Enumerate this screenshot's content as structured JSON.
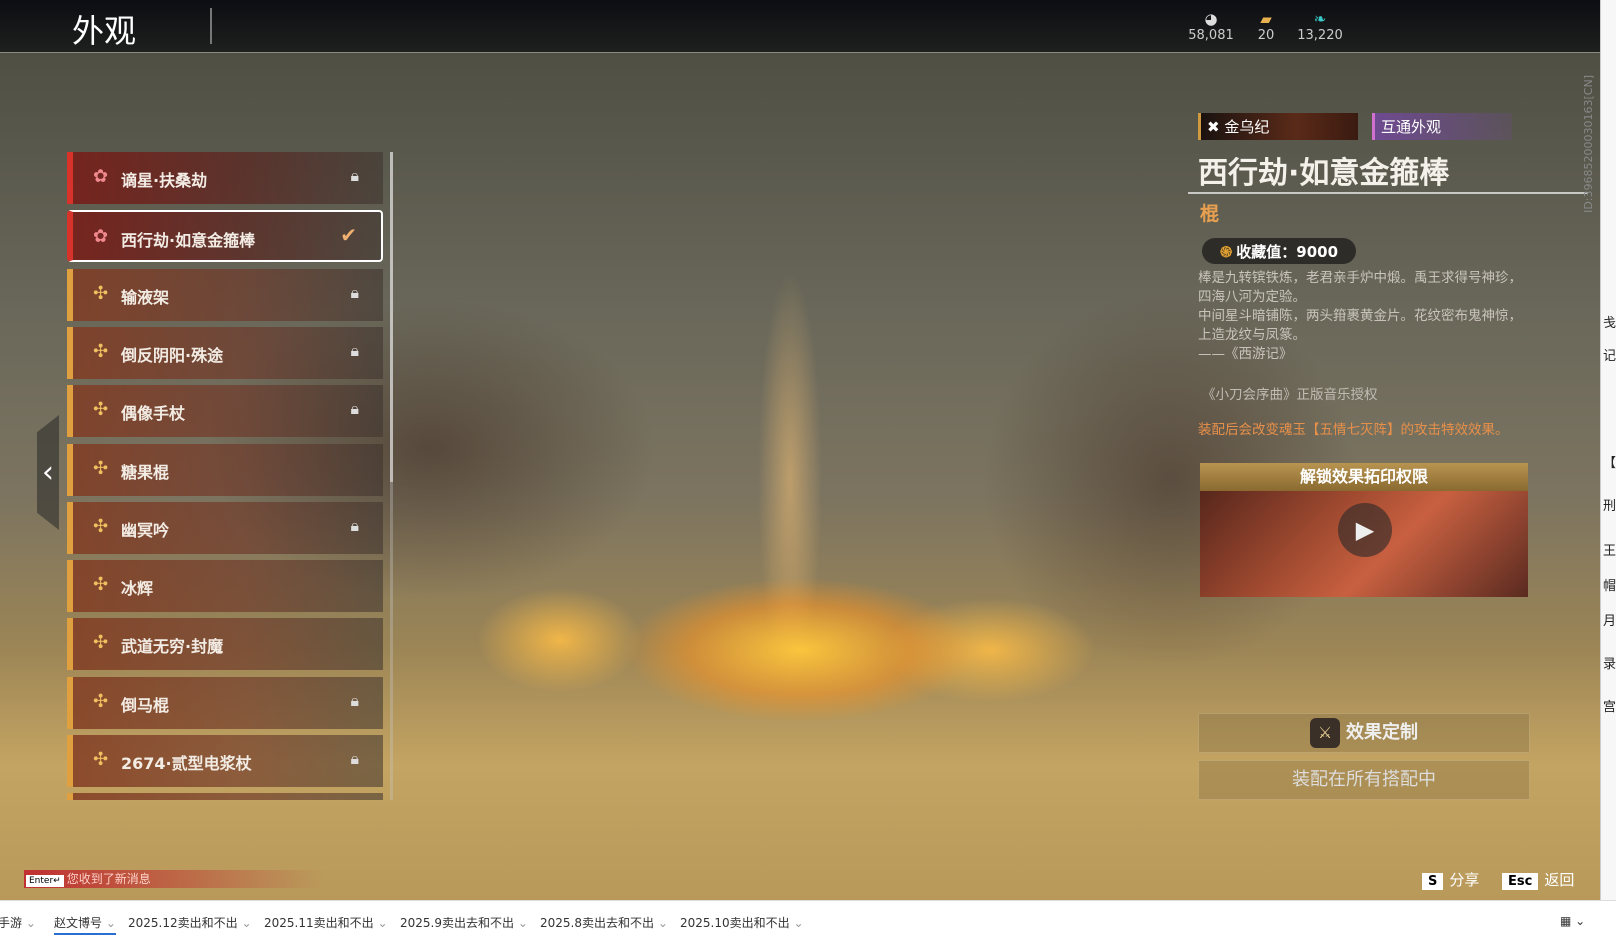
{
  "header": {
    "title": "外观",
    "currencies": [
      {
        "icon": "coin-icon",
        "value": "58,081"
      },
      {
        "icon": "ticket-icon",
        "value": "20"
      },
      {
        "icon": "feather-icon",
        "value": "13,220"
      }
    ]
  },
  "list": [
    {
      "name": "谪星·扶桑劫",
      "rarity": "red",
      "locked": true,
      "selected": false
    },
    {
      "name": "西行劫·如意金箍棒",
      "rarity": "red",
      "locked": false,
      "selected": true
    },
    {
      "name": "输液架",
      "rarity": "gold",
      "locked": true
    },
    {
      "name": "倒反阴阳·殊途",
      "rarity": "gold",
      "locked": true
    },
    {
      "name": "偶像手杖",
      "rarity": "gold",
      "locked": true
    },
    {
      "name": "糖果棍",
      "rarity": "gold",
      "locked": false
    },
    {
      "name": "幽冥吟",
      "rarity": "gold",
      "locked": true
    },
    {
      "name": "冰辉",
      "rarity": "gold",
      "locked": false
    },
    {
      "name": "武道无穷·封魔",
      "rarity": "gold",
      "locked": false
    },
    {
      "name": "倒马棍",
      "rarity": "gold",
      "locked": true
    },
    {
      "name": "2674·贰型电浆杖",
      "rarity": "gold",
      "locked": true
    }
  ],
  "detail": {
    "tag_series": "金乌纪",
    "tag_shared": "互通外观",
    "name": "西行劫·如意金箍棒",
    "type": "棍",
    "collect_label": "收藏值：9000",
    "desc": [
      "棒是九转镔铁炼，老君亲手炉中煅。禹王求得号神珍，四海八河为定验。",
      "中间星斗暗铺陈，两头箝裹黄金片。花纹密布鬼神惊，上造龙纹与凤篆。",
      "——《西游记》"
    ],
    "music": "《小刀会序曲》正版音乐授权",
    "effect": "装配后会改变魂玉【五情七灭阵】的攻击特效效果。",
    "video_title": "解锁效果拓印权限",
    "btn_custom": "效果定制",
    "btn_equip": "装配在所有搭配中"
  },
  "id_text": "ID:39685200030163[CN]",
  "notice": {
    "key": "Enter↵",
    "text": "您收到了新消息"
  },
  "keys": [
    {
      "key": "S",
      "label": "分享"
    },
    {
      "key": "Esc",
      "label": "返回"
    }
  ],
  "tabs": [
    "手游",
    "赵文博号",
    "2025.12卖出和不出",
    "2025.11卖出和不出",
    "2025.9卖出去和不出",
    "2025.8卖出去和不出",
    "2025.10卖出和不出"
  ],
  "strip": [
    "戋",
    "记单",
    "【报",
    "刑",
    "王儿",
    "帽",
    "月为",
    "录野",
    "宫("
  ]
}
